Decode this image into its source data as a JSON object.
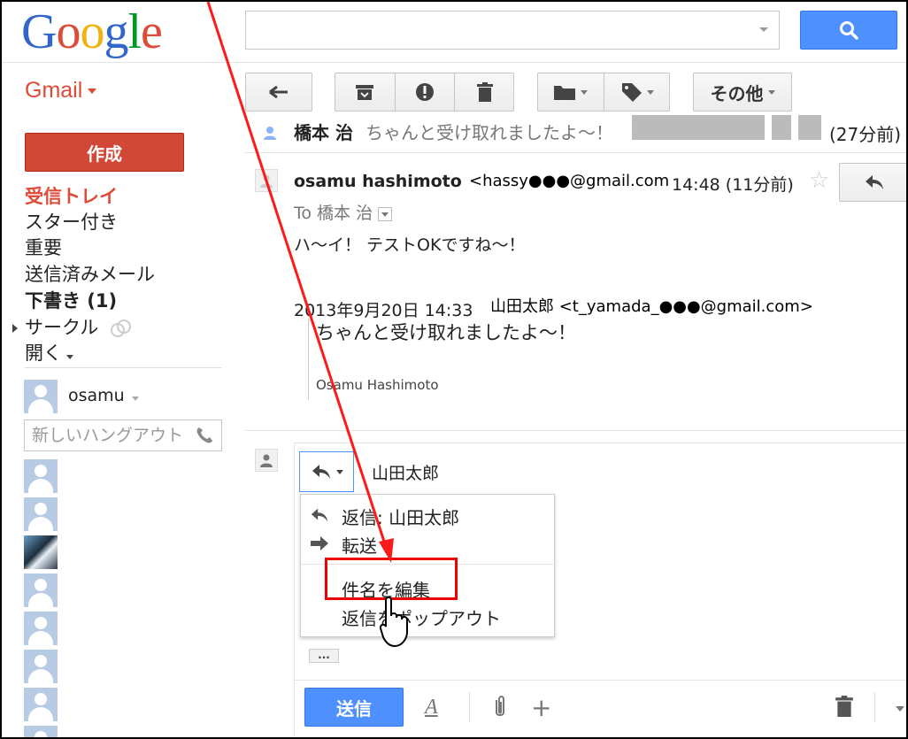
{
  "header": {
    "logo_letters": [
      "G",
      "o",
      "o",
      "g",
      "l",
      "e"
    ],
    "logo_colors": [
      "#3366cc",
      "#dd4b39",
      "#eeb211",
      "#3366cc",
      "#009925",
      "#dd4b39"
    ]
  },
  "app": {
    "label": "Gmail"
  },
  "toolbar": {
    "more_label": "その他"
  },
  "nav": {
    "compose_label": "作成",
    "items": [
      "受信トレイ",
      "スター付き",
      "重要",
      "送信済みメール",
      "下書き (1)",
      "サークル",
      "開く"
    ]
  },
  "chat": {
    "user_name": "osamu",
    "hangout_placeholder": "新しいハングアウト"
  },
  "thread": {
    "collapsed": {
      "sender": "橋本 治",
      "snippet": "ちゃんと受け取れましたよ～！",
      "time": "(27分前)"
    },
    "message": {
      "sender_name": "osamu hashimoto",
      "sender_email": "<hassy●●●@gmail.com",
      "time": "14:48 (11分前)",
      "to_line": "To 橋本 治",
      "body": "ハ～イ！ テストOKですね～！",
      "quote_header": "2013年9月20日 14:33",
      "quote_from": "山田太郎 <t_yamada_●●●@gmail.com>",
      "quote_body": "ちゃんと受け取れましたよ～！",
      "quote_signature": "Osamu Hashimoto"
    }
  },
  "reply": {
    "recipient": "山田太郎",
    "menu": {
      "reply_item": "返信: 山田太郎",
      "forward_item": "転送",
      "edit_subject_item": "件名を編集",
      "popout_item": "返信をポップアウト"
    },
    "more_label": "...",
    "send_label": "送信"
  },
  "colors": {
    "accent_blue": "#4d90fe",
    "compose_red": "#d14836",
    "highlight_red": "#ee0000"
  }
}
